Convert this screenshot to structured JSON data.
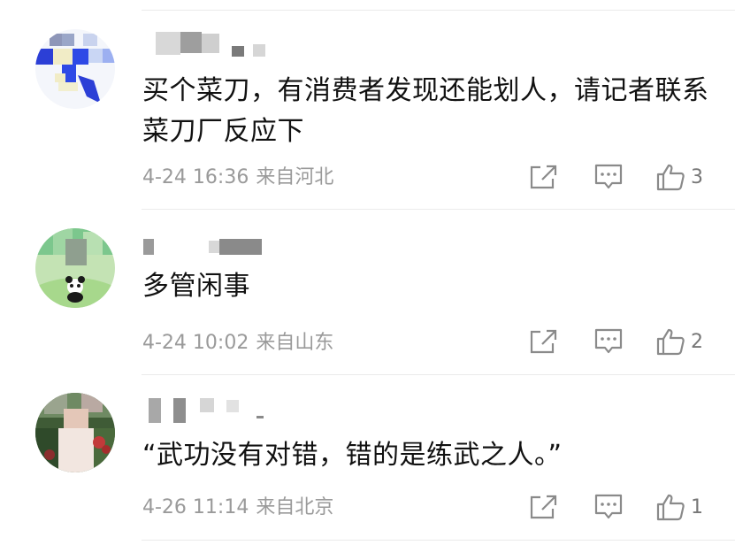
{
  "comments": [
    {
      "text": "买个菜刀，有消费者发现还能划人，请记者联系菜刀厂反应下",
      "date": "4-24 16:36",
      "location": "来自河北",
      "likes": "3"
    },
    {
      "text": "多管闲事",
      "date": "4-24 10:02",
      "location": "来自山东",
      "likes": "2"
    },
    {
      "text": "“武功没有对错，错的是练武之人。”",
      "date": "4-26 11:14",
      "location": "来自北京",
      "likes": "1"
    }
  ],
  "icons": {
    "share": "share-icon",
    "reply": "comment-icon",
    "like": "thumbs-up-icon"
  },
  "colors": {
    "text": "#111111",
    "meta": "#9a9a9a",
    "icon": "#8a8a8a",
    "divider": "#ebebeb"
  }
}
